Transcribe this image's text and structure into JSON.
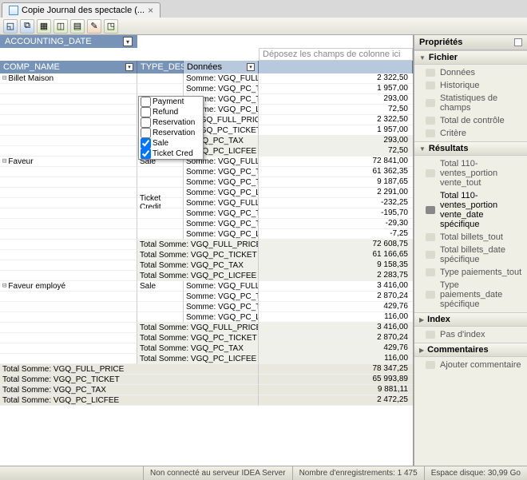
{
  "tab": {
    "title": "Copie Journal des spectacle (..."
  },
  "pivot": {
    "accounting_date": "ACCOUNTING_DATE",
    "comp_name": "COMP_NAME",
    "type_desc": "TYPE_DESC",
    "data_col": "Données",
    "drop_hint": "Déposez les champs de colonne ici"
  },
  "filter_options": [
    {
      "label": "Payment",
      "checked": false
    },
    {
      "label": "Refund",
      "checked": false
    },
    {
      "label": "Reservation",
      "checked": false
    },
    {
      "label": "Reservation",
      "checked": false
    },
    {
      "label": "Sale",
      "checked": true
    },
    {
      "label": "Ticket Cred",
      "checked": true
    }
  ],
  "groups": [
    {
      "comp": "Billet Maison",
      "types": [
        {
          "type": "",
          "rows": [
            {
              "label": "Somme: VGQ_FULL_PRICE",
              "val": "2 322,50"
            },
            {
              "label": "Somme: VGQ_PC_TICKET",
              "val": "1 957,00"
            },
            {
              "label": "Somme: VGQ_PC_TAX",
              "val": "293,00"
            },
            {
              "label": "Somme: VGQ_PC_LICFEE",
              "val": "72,50"
            }
          ]
        },
        {
          "type": "",
          "rows": [
            {
              "label": "e: VGQ_FULL_PRICE",
              "val": "2 322,50"
            },
            {
              "label": "e: VGQ_PC_TICKET",
              "val": "1 957,00"
            }
          ]
        }
      ],
      "subtotals": [
        {
          "label": "Total Somme: VGQ_PC_TAX",
          "val": "293,00"
        },
        {
          "label": "Total Somme: VGQ_PC_LICFEE",
          "val": "72,50"
        }
      ]
    },
    {
      "comp": "Faveur",
      "types": [
        {
          "type": "Sale",
          "rows": [
            {
              "label": "Somme: VGQ_FULL_PRICE",
              "val": "72 841,00"
            },
            {
              "label": "Somme: VGQ_PC_TICKET",
              "val": "61 362,35"
            },
            {
              "label": "Somme: VGQ_PC_TAX",
              "val": "9 187,65"
            },
            {
              "label": "Somme: VGQ_PC_LICFEE",
              "val": "2 291,00"
            }
          ]
        },
        {
          "type": "Ticket Credit",
          "rows": [
            {
              "label": "Somme: VGQ_FULL_PRICE",
              "val": "-232,25"
            },
            {
              "label": "Somme: VGQ_PC_TICKET",
              "val": "-195,70"
            },
            {
              "label": "Somme: VGQ_PC_TAX",
              "val": "-29,30"
            },
            {
              "label": "Somme: VGQ_PC_LICFEE",
              "val": "-7,25"
            }
          ]
        }
      ],
      "subtotals": [
        {
          "label": "Total Somme: VGQ_FULL_PRICE",
          "val": "72 608,75"
        },
        {
          "label": "Total Somme: VGQ_PC_TICKET",
          "val": "61 166,65"
        },
        {
          "label": "Total Somme: VGQ_PC_TAX",
          "val": "9 158,35"
        },
        {
          "label": "Total Somme: VGQ_PC_LICFEE",
          "val": "2 283,75"
        }
      ]
    },
    {
      "comp": "Faveur employé",
      "types": [
        {
          "type": "Sale",
          "rows": [
            {
              "label": "Somme: VGQ_FULL_PRICE",
              "val": "3 416,00"
            },
            {
              "label": "Somme: VGQ_PC_TICKET",
              "val": "2 870,24"
            },
            {
              "label": "Somme: VGQ_PC_TAX",
              "val": "429,76"
            },
            {
              "label": "Somme: VGQ_PC_LICFEE",
              "val": "116,00"
            }
          ]
        }
      ],
      "subtotals": [
        {
          "label": "Total Somme: VGQ_FULL_PRICE",
          "val": "3 416,00"
        },
        {
          "label": "Total Somme: VGQ_PC_TICKET",
          "val": "2 870,24"
        },
        {
          "label": "Total Somme: VGQ_PC_TAX",
          "val": "429,76"
        },
        {
          "label": "Total Somme: VGQ_PC_LICFEE",
          "val": "116,00"
        }
      ]
    }
  ],
  "grand_totals": [
    {
      "label": "Total Somme: VGQ_FULL_PRICE",
      "val": "78 347,25"
    },
    {
      "label": "Total Somme: VGQ_PC_TICKET",
      "val": "65 993,89"
    },
    {
      "label": "Total Somme: VGQ_PC_TAX",
      "val": "9 881,11"
    },
    {
      "label": "Total Somme: VGQ_PC_LICFEE",
      "val": "2 472,25"
    }
  ],
  "props": {
    "title": "Propriétés",
    "fichier": {
      "title": "Fichier",
      "items": [
        "Données",
        "Historique",
        "Statistiques de champs",
        "Total de contrôle",
        "Critère"
      ]
    },
    "resultats": {
      "title": "Résultats",
      "items": [
        "Total 110-ventes_portion vente_tout",
        "Total 110-ventes_portion vente_date spécifique",
        "Total billets_tout",
        "Total billets_date spécifique",
        "Type paiements_tout",
        "Type paiements_date spécifique"
      ],
      "selected": 1
    },
    "index": {
      "title": "Index",
      "items": [
        "Pas d'index"
      ]
    },
    "comments": {
      "title": "Commentaires",
      "items": [
        "Ajouter commentaire"
      ]
    }
  },
  "status": {
    "server": "Non connecté au serveur IDEA Server",
    "records": "Nombre d'enregistrements: 1 475",
    "disk": "Espace disque: 30,99 Go"
  }
}
